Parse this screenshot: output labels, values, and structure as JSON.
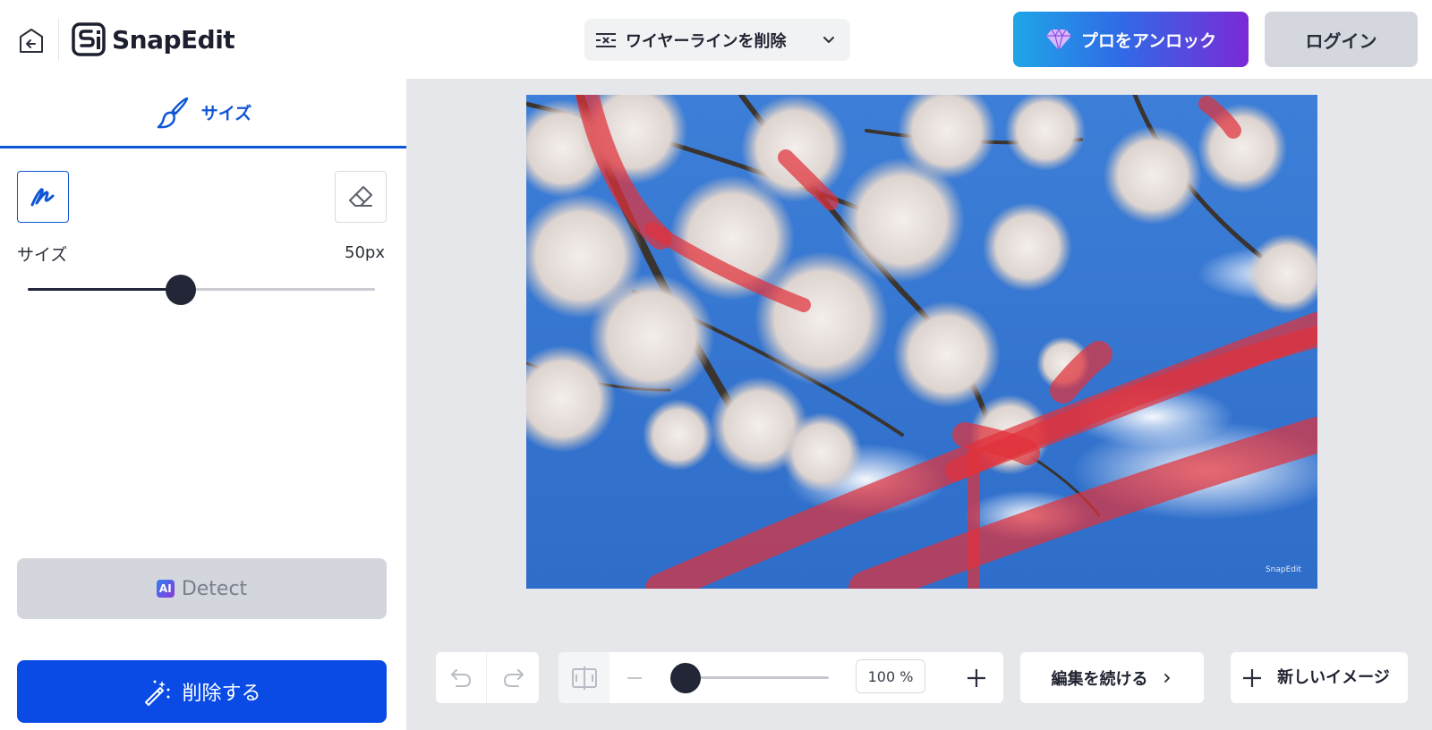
{
  "header": {
    "logo_text": "SnapEdit",
    "tool_select_label": "ワイヤーラインを削除",
    "pro_button_label": "プロをアンロック",
    "login_button_label": "ログイン"
  },
  "sidebar": {
    "tab_label": "サイズ",
    "size_label": "サイズ",
    "size_value": "50px",
    "brush_size_fraction": 0.44,
    "detect_label": "Detect",
    "ai_badge": "AI",
    "remove_label": "削除する"
  },
  "canvas": {
    "watermark": "SnapEdit"
  },
  "bottom_bar": {
    "zoom_value": "100 %",
    "zoom_fraction": 0.0,
    "continue_label": "編集を続ける",
    "new_image_label": "新しいイメージ"
  },
  "colors": {
    "accent": "#0f56d6",
    "primary_button": "#0a4be6",
    "mask": "#e0323c"
  }
}
